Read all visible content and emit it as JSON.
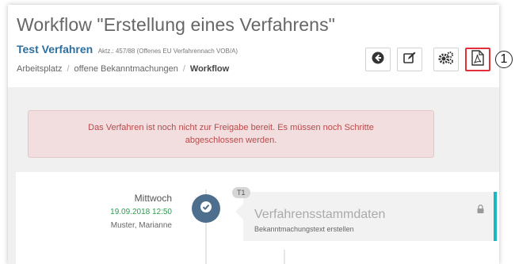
{
  "header": {
    "title": "Workflow \"Erstellung eines Verfahrens\"",
    "procedure_name": "Test Verfahren",
    "procedure_ref": "Aktz.: 457/88 (Offenes EU Verfahrennach VOB/A)"
  },
  "breadcrumb": [
    "Arbeitsplatz",
    "offene Bekanntmachungen",
    "Workflow"
  ],
  "toolbar": {
    "buttons": [
      {
        "icon": "back-arrow-circle-icon"
      },
      {
        "icon": "edit-icon"
      },
      {
        "icon": "settings-gears-icon"
      },
      {
        "icon": "pdf-icon",
        "highlighted": true
      }
    ],
    "highlight_color": "#e0313a"
  },
  "callout": {
    "number": "1"
  },
  "alert": {
    "text": "Das Verfahren ist noch nicht zur Freigabe bereit. Es müssen noch Schritte abgeschlossen werden."
  },
  "timeline": {
    "day": "Mittwoch",
    "datetime": "19.09.2018 12:50",
    "user": "Muster, Marianne",
    "step_badge": "T1",
    "step_title": "Verfahrensstammdaten",
    "step_description": "Bekanntmachungstext erstellen",
    "status_icon": "check-icon",
    "lock_icon": "lock-icon",
    "accent_color": "#17b8c2"
  }
}
